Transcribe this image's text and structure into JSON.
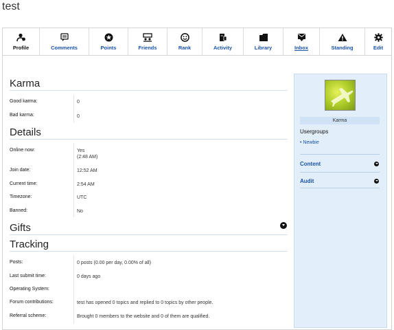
{
  "page": {
    "title": "test"
  },
  "tabs": [
    {
      "label": "Profile",
      "icon": "users-icon"
    },
    {
      "label": "Comments",
      "icon": "comment-icon"
    },
    {
      "label": "Points",
      "icon": "star-badge-icon"
    },
    {
      "label": "Friends",
      "icon": "friends-icon"
    },
    {
      "label": "Rank",
      "icon": "rank-icon"
    },
    {
      "label": "Activity",
      "icon": "activity-icon"
    },
    {
      "label": "Library",
      "icon": "library-icon"
    },
    {
      "label": "Inbox",
      "icon": "inbox-icon"
    },
    {
      "label": "Standing",
      "icon": "warning-icon"
    },
    {
      "label": "Edit",
      "icon": "gear-icon"
    }
  ],
  "karma": {
    "heading": "Karma",
    "rows": [
      {
        "label": "Good karma:",
        "value": "0"
      },
      {
        "label": "Bad karma:",
        "value": "0"
      }
    ]
  },
  "details": {
    "heading": "Details",
    "online": {
      "label": "Online now:",
      "value": "Yes",
      "sub": "(2:48 AM)"
    },
    "rows": [
      {
        "label": "Join date:",
        "value": "12:52 AM"
      },
      {
        "label": "Current time:",
        "value": "2:54 AM"
      },
      {
        "label": "Timezone:",
        "value": "UTC"
      },
      {
        "label": "Banned:",
        "value": "No"
      }
    ]
  },
  "gifts": {
    "heading": "Gifts"
  },
  "tracking": {
    "heading": "Tracking",
    "rows": [
      {
        "label": "Posts:",
        "value": "0 posts (0.00 per day, 0.00% of all)"
      },
      {
        "label": "Last submit time:",
        "value": "0 days ago"
      },
      {
        "label": "Operating System:",
        "value": ""
      },
      {
        "label": "Forum contributions:",
        "value": "test has opened 0 topics and replied to 0 topics by other people."
      },
      {
        "label": "Referral scheme:",
        "value": "Brought 0 members to the website and 0 of them are qualified."
      }
    ]
  },
  "sidebar": {
    "karma_label": "Karma",
    "usergroups_title": "Usergroups",
    "usergroups": [
      "Newbie"
    ],
    "links": [
      {
        "label": "Content"
      },
      {
        "label": "Audit"
      }
    ]
  },
  "colors": {
    "accent": "#1a52a8",
    "sidebar_bg": "#e2eefa",
    "section_rule": "#cfe0f0"
  }
}
